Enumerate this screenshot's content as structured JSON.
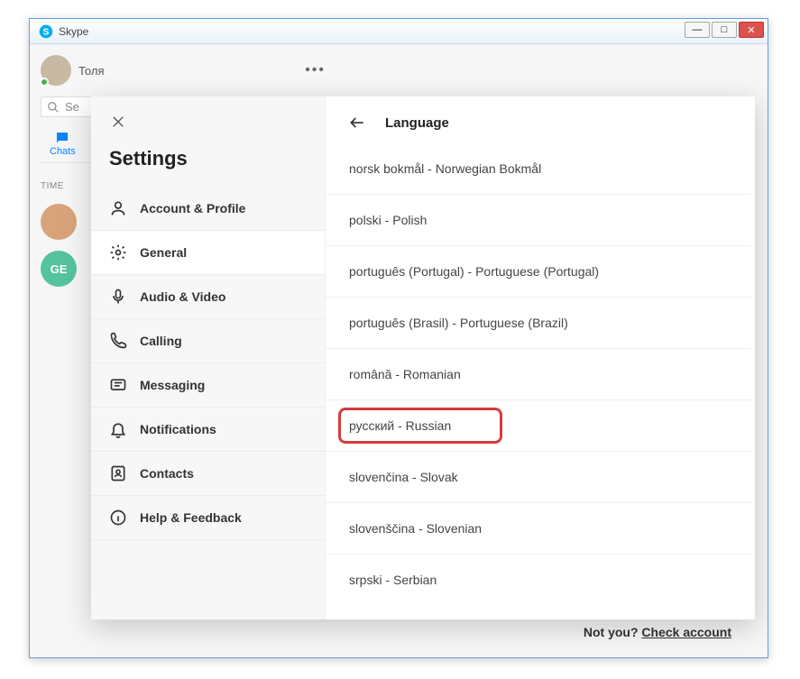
{
  "window": {
    "title": "Skype",
    "controls": {
      "min": "—",
      "max": "□",
      "close": "✕"
    }
  },
  "backdrop": {
    "profile_name": "Толя",
    "more_dots": "•••",
    "search_placeholder": "Se",
    "tab_chats": "Chats",
    "section_time": "TIME",
    "contact_ge": "GE",
    "footer_notyou": "Not you?",
    "footer_link": "Check account"
  },
  "settings": {
    "title": "Settings",
    "nav": [
      {
        "label": "Account & Profile",
        "key": "account"
      },
      {
        "label": "General",
        "key": "general"
      },
      {
        "label": "Audio & Video",
        "key": "audio"
      },
      {
        "label": "Calling",
        "key": "calling"
      },
      {
        "label": "Messaging",
        "key": "messaging"
      },
      {
        "label": "Notifications",
        "key": "notifications"
      },
      {
        "label": "Contacts",
        "key": "contacts"
      },
      {
        "label": "Help & Feedback",
        "key": "help"
      }
    ],
    "active_key": "general"
  },
  "language": {
    "header": "Language",
    "items": [
      "norsk bokmål - Norwegian Bokmål",
      "polski - Polish",
      "português (Portugal) - Portuguese (Portugal)",
      "português (Brasil) - Portuguese (Brazil)",
      "română - Romanian",
      "русский - Russian",
      "slovenčina - Slovak",
      "slovenščina - Slovenian",
      "srpski - Serbian"
    ],
    "highlight_index": 5
  }
}
